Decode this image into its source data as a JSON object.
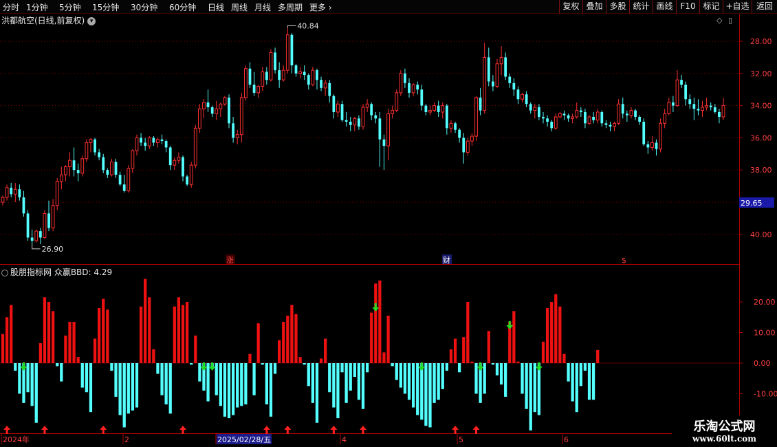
{
  "toolbar": {
    "periods": [
      "分时",
      "1分钟",
      "5分钟",
      "15分钟",
      "30分钟",
      "60分钟",
      "日线",
      "周线",
      "月线",
      "多周期",
      "更多"
    ],
    "active_period": "日线",
    "more_arrow": "chevron-right-icon",
    "buttons": [
      "复权",
      "叠加",
      "多股",
      "统计",
      "画线",
      "F10",
      "标记",
      "+自选",
      "返回"
    ]
  },
  "main_panel": {
    "title": "洪都航空(日线,前复权)",
    "high_label": "40.84",
    "low_label": "26.90",
    "price_ticks": [
      "40.00",
      "38.00",
      "36.00",
      "34.00",
      "32.00",
      "28.00"
    ],
    "current_price_tag": "29.65",
    "event_markers": [
      "涨",
      "财",
      "$"
    ]
  },
  "indicator_panel": {
    "title": "股朋指标网 众赢BBD: 4.29",
    "value_ticks": [
      "20.00",
      "10.00",
      "0.00",
      "-10.00"
    ]
  },
  "date_axis": {
    "labels": [
      "2024年",
      "2",
      "2025/02/28/五",
      "4",
      "5",
      "6"
    ]
  },
  "watermark": {
    "title": "乐淘公式网",
    "url": "www.60lt.com"
  },
  "colors": {
    "up": "#ff3030",
    "down": "#54ffff",
    "background": "#000000",
    "grid": "#8b0000",
    "axis_text": "#ff4040"
  },
  "chart_data": {
    "type": "candlestick",
    "title": "洪都航空(日线,前复权)",
    "y_range": [
      26.5,
      41.5
    ],
    "y_ticks": [
      28,
      32,
      34,
      36,
      38,
      40
    ],
    "candles": [
      [
        30.0,
        30.4,
        29.8,
        30.3
      ],
      [
        30.3,
        31.1,
        30.1,
        30.9
      ],
      [
        30.9,
        31.2,
        30.3,
        30.5
      ],
      [
        30.5,
        31.2,
        30.0,
        30.8
      ],
      [
        30.8,
        31.1,
        30.1,
        30.3
      ],
      [
        30.3,
        30.7,
        29.1,
        29.3
      ],
      [
        29.3,
        29.5,
        27.6,
        27.8
      ],
      [
        27.8,
        28.3,
        27.4,
        27.6
      ],
      [
        27.6,
        28.3,
        27.5,
        28.2
      ],
      [
        28.2,
        28.4,
        27.4,
        27.8
      ],
      [
        27.8,
        29.5,
        27.7,
        29.3
      ],
      [
        29.3,
        30.1,
        28.2,
        28.4
      ],
      [
        28.4,
        30.2,
        28.2,
        29.8
      ],
      [
        29.8,
        31.5,
        29.5,
        31.3
      ],
      [
        31.3,
        32.2,
        30.8,
        31.7
      ],
      [
        31.7,
        32.3,
        31.3,
        32.2
      ],
      [
        32.2,
        33.1,
        31.6,
        32.6
      ],
      [
        32.6,
        33.4,
        31.6,
        32.0
      ],
      [
        32.0,
        32.4,
        31.3,
        31.8
      ],
      [
        31.8,
        32.9,
        31.6,
        32.7
      ],
      [
        32.7,
        33.9,
        32.5,
        33.7
      ],
      [
        33.7,
        34.0,
        33.1,
        33.9
      ],
      [
        33.9,
        34.0,
        32.9,
        33.1
      ],
      [
        33.1,
        33.3,
        32.6,
        32.8
      ],
      [
        32.8,
        33.0,
        31.8,
        32.0
      ],
      [
        32.0,
        32.1,
        31.5,
        31.7
      ],
      [
        31.7,
        32.7,
        31.6,
        32.5
      ],
      [
        32.5,
        32.7,
        31.5,
        31.7
      ],
      [
        31.7,
        31.9,
        31.0,
        31.1
      ],
      [
        31.1,
        31.7,
        30.6,
        30.7
      ],
      [
        30.7,
        32.3,
        30.6,
        32.1
      ],
      [
        32.1,
        33.3,
        31.8,
        33.2
      ],
      [
        33.2,
        34.2,
        32.9,
        34.0
      ],
      [
        34.0,
        34.3,
        33.5,
        33.7
      ],
      [
        33.7,
        34.0,
        33.2,
        33.5
      ],
      [
        33.5,
        34.1,
        33.3,
        34.0
      ],
      [
        34.0,
        34.1,
        33.5,
        33.7
      ],
      [
        33.7,
        34.0,
        33.4,
        33.9
      ],
      [
        33.9,
        34.2,
        33.6,
        33.8
      ],
      [
        33.8,
        33.9,
        33.1,
        33.4
      ],
      [
        33.4,
        33.5,
        32.0,
        32.3
      ],
      [
        32.3,
        32.8,
        32.0,
        32.6
      ],
      [
        32.6,
        33.1,
        32.4,
        32.8
      ],
      [
        32.8,
        32.9,
        31.3,
        31.6
      ],
      [
        31.6,
        31.7,
        31.0,
        31.1
      ],
      [
        31.1,
        32.5,
        30.9,
        32.3
      ],
      [
        32.3,
        34.8,
        32.1,
        34.6
      ],
      [
        34.6,
        36.1,
        34.3,
        35.8
      ],
      [
        35.8,
        36.4,
        35.2,
        36.2
      ],
      [
        36.2,
        37.0,
        35.6,
        35.9
      ],
      [
        35.9,
        36.0,
        35.3,
        35.5
      ],
      [
        35.5,
        36.3,
        35.1,
        35.8
      ],
      [
        35.8,
        36.2,
        35.3,
        36.1
      ],
      [
        36.1,
        36.6,
        36.0,
        36.5
      ],
      [
        36.5,
        36.7,
        34.6,
        34.9
      ],
      [
        34.9,
        35.3,
        33.7,
        34.0
      ],
      [
        34.0,
        34.5,
        33.6,
        34.2
      ],
      [
        34.2,
        36.8,
        33.7,
        36.5
      ],
      [
        36.5,
        38.5,
        36.3,
        38.3
      ],
      [
        38.3,
        38.7,
        37.1,
        37.3
      ],
      [
        37.3,
        38.1,
        36.6,
        36.8
      ],
      [
        36.8,
        37.3,
        36.5,
        37.2
      ],
      [
        37.2,
        38.4,
        36.9,
        38.1
      ],
      [
        38.1,
        38.4,
        37.3,
        37.6
      ],
      [
        37.6,
        39.5,
        37.5,
        39.3
      ],
      [
        39.3,
        39.6,
        38.0,
        38.2
      ],
      [
        38.2,
        38.7,
        37.1,
        37.6
      ],
      [
        37.6,
        38.5,
        37.5,
        38.2
      ],
      [
        38.2,
        40.84,
        38.0,
        40.4
      ],
      [
        40.4,
        40.5,
        38.0,
        38.5
      ],
      [
        38.5,
        38.6,
        37.8,
        38.0
      ],
      [
        38.0,
        38.4,
        37.7,
        38.1
      ],
      [
        38.1,
        38.5,
        37.6,
        37.9
      ],
      [
        37.9,
        38.0,
        37.0,
        37.3
      ],
      [
        37.3,
        38.4,
        37.2,
        38.2
      ],
      [
        38.2,
        38.3,
        37.0,
        37.6
      ],
      [
        37.6,
        37.8,
        36.9,
        37.1
      ],
      [
        37.1,
        37.6,
        36.6,
        37.4
      ],
      [
        37.4,
        37.6,
        36.2,
        36.6
      ],
      [
        36.6,
        36.7,
        35.2,
        35.6
      ],
      [
        35.6,
        36.3,
        35.3,
        36.1
      ],
      [
        36.1,
        36.3,
        35.0,
        35.1
      ],
      [
        35.1,
        35.6,
        34.7,
        35.0
      ],
      [
        35.0,
        35.3,
        34.4,
        34.8
      ],
      [
        34.8,
        35.3,
        34.4,
        35.2
      ],
      [
        35.2,
        35.4,
        34.5,
        34.7
      ],
      [
        34.7,
        36.1,
        34.5,
        35.9
      ],
      [
        35.9,
        36.4,
        35.6,
        36.1
      ],
      [
        36.1,
        36.2,
        35.1,
        35.4
      ],
      [
        35.4,
        35.6,
        34.9,
        35.2
      ],
      [
        35.2,
        35.6,
        32.2,
        33.9
      ],
      [
        33.9,
        34.2,
        32.0,
        33.5
      ],
      [
        33.5,
        35.8,
        32.6,
        35.5
      ],
      [
        35.5,
        36.0,
        35.2,
        35.7
      ],
      [
        35.7,
        37.0,
        35.6,
        36.8
      ],
      [
        36.8,
        38.2,
        36.6,
        38.0
      ],
      [
        38.0,
        38.3,
        37.1,
        37.4
      ],
      [
        37.4,
        37.7,
        36.5,
        36.8
      ],
      [
        36.8,
        37.4,
        36.6,
        37.3
      ],
      [
        37.3,
        37.5,
        36.7,
        37.0
      ],
      [
        37.0,
        37.3,
        35.7,
        36.0
      ],
      [
        36.0,
        36.1,
        35.4,
        35.6
      ],
      [
        35.6,
        36.0,
        35.4,
        35.7
      ],
      [
        35.7,
        36.2,
        35.6,
        36.0
      ],
      [
        36.0,
        36.3,
        35.3,
        35.6
      ],
      [
        35.6,
        36.2,
        35.2,
        36.0
      ],
      [
        36.0,
        36.1,
        34.2,
        34.6
      ],
      [
        34.6,
        35.1,
        34.3,
        34.9
      ],
      [
        34.9,
        35.0,
        34.3,
        34.5
      ],
      [
        34.5,
        34.6,
        33.7,
        34.0
      ],
      [
        34.0,
        34.3,
        32.4,
        33.1
      ],
      [
        33.1,
        34.0,
        32.9,
        33.8
      ],
      [
        33.8,
        34.3,
        33.5,
        34.1
      ],
      [
        34.1,
        36.6,
        33.8,
        36.5
      ],
      [
        36.5,
        37.1,
        35.4,
        35.7
      ],
      [
        35.7,
        39.9,
        35.5,
        39.0
      ],
      [
        39.0,
        39.6,
        37.2,
        37.5
      ],
      [
        37.5,
        37.9,
        36.9,
        37.2
      ],
      [
        37.2,
        38.9,
        37.1,
        38.6
      ],
      [
        38.6,
        39.7,
        37.9,
        39.0
      ],
      [
        39.0,
        39.3,
        37.6,
        37.8
      ],
      [
        37.8,
        38.0,
        37.1,
        37.4
      ],
      [
        37.4,
        37.7,
        36.6,
        37.0
      ],
      [
        37.0,
        37.2,
        36.1,
        36.4
      ],
      [
        36.4,
        36.8,
        36.2,
        36.7
      ],
      [
        36.7,
        36.9,
        35.9,
        36.1
      ],
      [
        36.1,
        36.2,
        35.5,
        35.7
      ],
      [
        35.7,
        36.1,
        35.2,
        35.9
      ],
      [
        35.9,
        36.1,
        35.1,
        35.3
      ],
      [
        35.3,
        35.6,
        34.9,
        35.2
      ],
      [
        35.2,
        35.4,
        34.7,
        35.0
      ],
      [
        35.0,
        35.1,
        34.4,
        34.6
      ],
      [
        34.6,
        35.5,
        34.5,
        35.3
      ],
      [
        35.3,
        35.6,
        35.2,
        35.5
      ],
      [
        35.5,
        35.7,
        35.1,
        35.4
      ],
      [
        35.4,
        35.5,
        35.0,
        35.2
      ],
      [
        35.2,
        35.5,
        34.9,
        35.3
      ],
      [
        35.3,
        36.2,
        35.2,
        35.7
      ],
      [
        35.7,
        35.9,
        35.3,
        35.6
      ],
      [
        35.6,
        35.8,
        34.6,
        34.9
      ],
      [
        34.9,
        35.4,
        34.8,
        35.3
      ],
      [
        35.3,
        35.6,
        34.9,
        35.1
      ],
      [
        35.1,
        35.8,
        34.9,
        35.6
      ],
      [
        35.6,
        35.7,
        34.7,
        34.9
      ],
      [
        34.9,
        35.1,
        34.6,
        34.8
      ],
      [
        34.8,
        35.0,
        34.4,
        34.7
      ],
      [
        34.7,
        35.0,
        34.4,
        34.9
      ],
      [
        34.9,
        36.4,
        34.8,
        36.1
      ],
      [
        36.1,
        36.5,
        35.2,
        35.5
      ],
      [
        35.5,
        35.7,
        35.0,
        35.4
      ],
      [
        35.4,
        35.9,
        35.2,
        35.7
      ],
      [
        35.7,
        35.8,
        35.1,
        35.3
      ],
      [
        35.3,
        35.4,
        34.8,
        35.0
      ],
      [
        35.0,
        35.2,
        33.5,
        33.6
      ],
      [
        33.6,
        33.8,
        33.0,
        33.4
      ],
      [
        33.4,
        34.1,
        33.2,
        33.7
      ],
      [
        33.7,
        33.9,
        32.9,
        33.3
      ],
      [
        33.3,
        35.2,
        33.1,
        34.9
      ],
      [
        34.9,
        35.8,
        34.6,
        35.5
      ],
      [
        35.5,
        36.5,
        35.4,
        36.2
      ],
      [
        36.2,
        36.6,
        35.6,
        36.0
      ],
      [
        36.0,
        38.2,
        35.9,
        37.6
      ],
      [
        37.6,
        37.9,
        37.1,
        37.3
      ],
      [
        37.3,
        37.5,
        36.0,
        36.4
      ],
      [
        36.4,
        36.7,
        35.8,
        36.1
      ],
      [
        36.1,
        36.5,
        35.1,
        35.8
      ],
      [
        35.8,
        36.4,
        35.4,
        35.7
      ],
      [
        35.7,
        36.3,
        35.3,
        35.9
      ],
      [
        35.9,
        36.5,
        35.7,
        36.0
      ],
      [
        36.0,
        36.2,
        35.7,
        35.9
      ],
      [
        35.9,
        36.1,
        35.5,
        35.6
      ],
      [
        35.6,
        35.8,
        34.9,
        35.3
      ],
      [
        35.3,
        36.5,
        35.1,
        36.0
      ]
    ],
    "indicator": {
      "name": "众赢BBD",
      "last_value": 4.29,
      "y_range": [
        -21,
        28
      ],
      "values": [
        9.5,
        15,
        19,
        -2.5,
        -10,
        -13,
        -9.5,
        -14,
        -19.5,
        6.5,
        21.5,
        20,
        17,
        -1,
        -6,
        9,
        13.5,
        13.5,
        2,
        -8,
        -9.5,
        -16,
        8,
        18,
        21,
        17.5,
        -2.5,
        -11,
        -17,
        -21,
        -16.5,
        -15.5,
        -14.5,
        18.5,
        27.5,
        21.5,
        4.5,
        -3.5,
        -10.5,
        -13.5,
        -16.5,
        18.5,
        21.5,
        19,
        20,
        -0.5,
        9,
        -6,
        -9,
        -12.5,
        -1.5,
        -10.5,
        -14,
        -17.5,
        -18,
        -17,
        -14.5,
        -14,
        -13.5,
        3,
        -10.5,
        13,
        -0.5,
        -13.5,
        -17.5,
        -3.5,
        7.5,
        13.5,
        15.5,
        19,
        16,
        2,
        -0.5,
        -7.5,
        -13,
        -19.5,
        1.5,
        8,
        -9.5,
        -14.5,
        -18,
        -3,
        -13,
        -9,
        -4.5,
        -12,
        -15,
        -3,
        16.5,
        26,
        27,
        3.5,
        15.5,
        -1,
        -5.5,
        -8,
        -10,
        -12,
        -14.5,
        -17,
        -18.5,
        -20.5,
        -21,
        -13,
        -12,
        -8.5,
        -2.5,
        4.5,
        8,
        -3,
        8.5,
        20,
        0.5,
        -10,
        -13,
        -10,
        10.5,
        -0.5,
        -4,
        -7,
        -11,
        13.5,
        17,
        0.5,
        -10,
        -15,
        -22,
        -16,
        -17,
        7,
        18,
        20,
        22.5,
        18.5,
        3,
        -6,
        -12.5,
        -16,
        -7.5,
        -2.5,
        -12,
        -12,
        4.3
      ],
      "buy_arrows": [
        1,
        10,
        24,
        43,
        63,
        68,
        79,
        86,
        108,
        113
      ],
      "sell_arrows": [
        5,
        48,
        50,
        89,
        100,
        114,
        121,
        128
      ]
    }
  }
}
